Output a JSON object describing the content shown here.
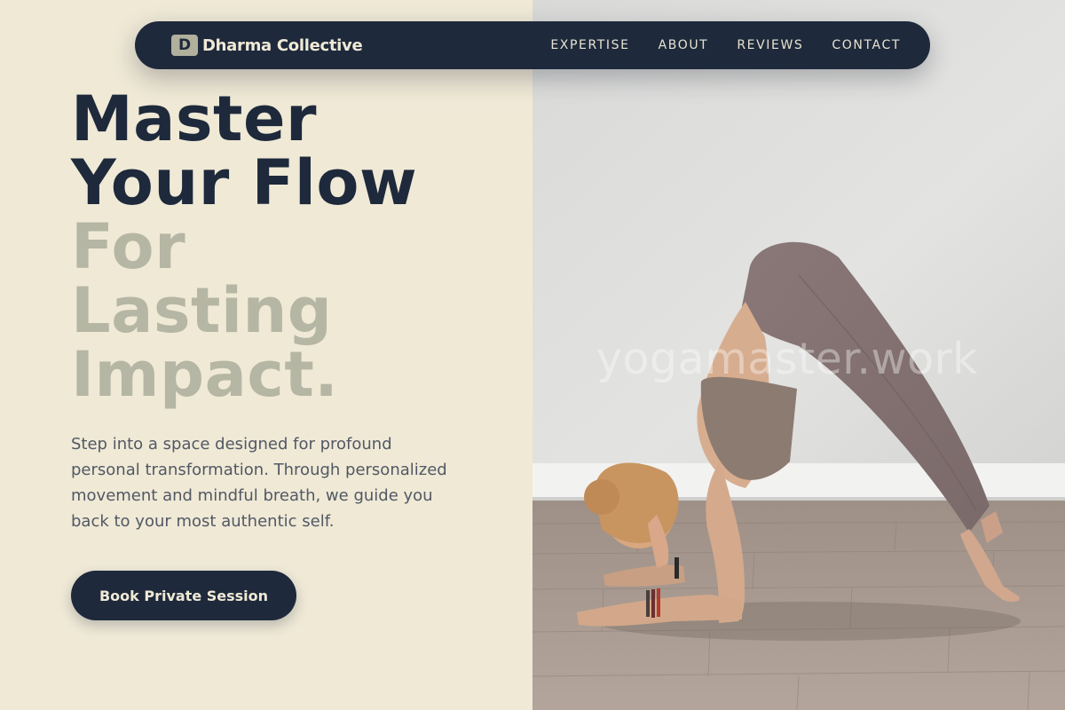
{
  "brand": {
    "mark": "D",
    "name": "Dharma Collective"
  },
  "nav": {
    "links": [
      "EXPERTISE",
      "ABOUT",
      "REVIEWS",
      "CONTACT"
    ]
  },
  "hero": {
    "headline_dark": [
      "Master",
      "Your Flow"
    ],
    "headline_muted": [
      "For",
      "Lasting",
      "Impact."
    ],
    "description": "Step into a space designed for profound personal transformation. Through personalized movement and mindful breath, we guide you back to your most authentic self.",
    "cta_label": "Book Private Session"
  },
  "photo": {
    "watermark": "yogamaster.work"
  },
  "colors": {
    "navy": "#1e293b",
    "cream": "#efe9d6",
    "sage": "#b5b6a3",
    "body_text": "#525864"
  }
}
